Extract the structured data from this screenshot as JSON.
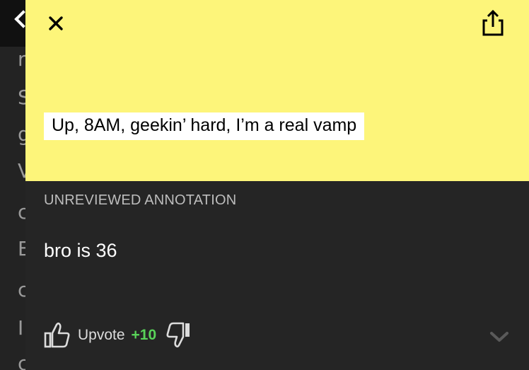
{
  "background_page": {
    "letters": [
      "r",
      "S",
      "g",
      "V",
      "c",
      "E",
      "c",
      "I",
      "c"
    ]
  },
  "modal": {
    "lyric": "Up, 8AM, geekin’ hard, I’m a real vamp",
    "annotation": {
      "status": "UNREVIEWED ANNOTATION",
      "body": "bro is 36"
    },
    "votes": {
      "upvote_label": "Upvote",
      "count": "+10"
    }
  },
  "colors": {
    "lyric_background": "#fdf57a",
    "annotation_background": "#252525",
    "vote_count": "#59d359"
  },
  "icons": {
    "close": "close-icon",
    "share": "share-icon",
    "upvote": "thumbs-up-icon",
    "downvote": "thumbs-down-icon",
    "expand": "chevron-down-icon"
  }
}
